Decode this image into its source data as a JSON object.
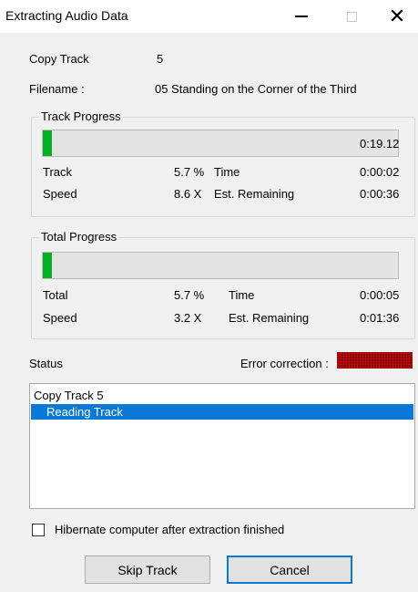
{
  "window": {
    "title": "Extracting Audio Data",
    "minimize_glyph": "–",
    "close_glyph": "✕"
  },
  "copy_track": {
    "label": "Copy Track",
    "value": "5"
  },
  "filename": {
    "label": "Filename :",
    "value": "05 Standing on the Corner of the Third"
  },
  "track_progress": {
    "label": "Track Progress",
    "progress_fraction": 0.025,
    "duration": "0:19.12",
    "track_label": "Track",
    "track_percent": "5.7 %",
    "time_label": "Time",
    "time_value": "0:00:02",
    "speed_label": "Speed",
    "speed_value": "8.6 X",
    "remaining_label": "Est. Remaining",
    "remaining_value": "0:00:36"
  },
  "total_progress": {
    "label": "Total Progress",
    "progress_fraction": 0.025,
    "total_label": "Total",
    "total_percent": "5.7 %",
    "time_label": "Time",
    "time_value": "0:00:05",
    "speed_label": "Speed",
    "speed_value": "3.2 X",
    "remaining_label": "Est. Remaining",
    "remaining_value": "0:01:36"
  },
  "status": {
    "label": "Status",
    "error_correction_label": "Error correction :",
    "lines": [
      "Copy Track  5",
      "Reading Track"
    ]
  },
  "hibernate": {
    "label": "Hibernate computer after extraction finished",
    "checked": false
  },
  "buttons": {
    "skip_track": "Skip Track",
    "cancel": "Cancel"
  },
  "colors": {
    "progress_green": "#06b025",
    "selection_blue": "#0a78d7",
    "error_led_red": "#8a0000"
  }
}
